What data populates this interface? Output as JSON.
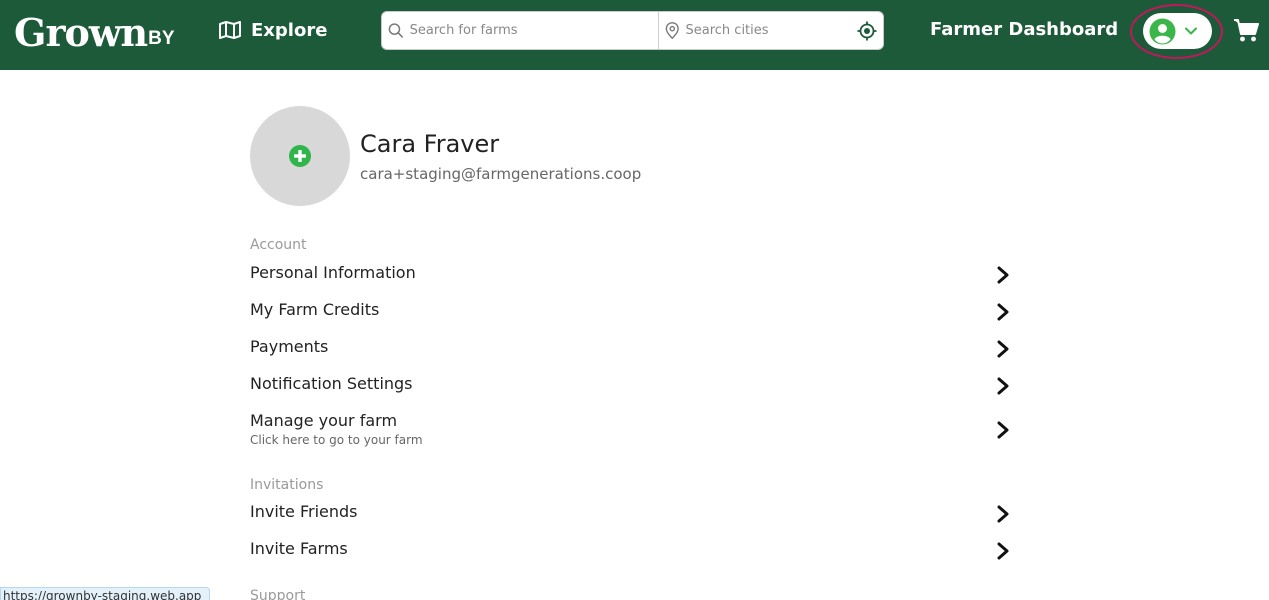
{
  "brand": {
    "logo_main": "Grown",
    "logo_by": "BY"
  },
  "header": {
    "explore_label": "Explore",
    "search_farms_placeholder": "Search for farms",
    "search_cities_placeholder": "Search cities",
    "dashboard_label": "Farmer Dashboard"
  },
  "profile": {
    "name": "Cara Fraver",
    "email": "cara+staging@farmgenerations.coop"
  },
  "sections": {
    "account": {
      "title": "Account",
      "items": [
        {
          "label": "Personal Information"
        },
        {
          "label": "My Farm Credits"
        },
        {
          "label": "Payments"
        },
        {
          "label": "Notification Settings"
        },
        {
          "label": "Manage your farm",
          "subtitle": "Click here to go to your farm"
        }
      ]
    },
    "invitations": {
      "title": "Invitations",
      "items": [
        {
          "label": "Invite Friends"
        },
        {
          "label": "Invite Farms"
        }
      ]
    },
    "support": {
      "title": "Support"
    }
  },
  "status_bar": {
    "url": "https://grownby-staging.web.app"
  },
  "colors": {
    "header_bg": "#1d5a3a",
    "accent_green": "#3cb54a",
    "highlight_ring": "#c2185b",
    "avatar_bg": "#d8d8d8"
  },
  "icons": [
    "map-icon",
    "search-icon",
    "location-pin-icon",
    "crosshair-icon",
    "user-avatar-icon",
    "chevron-down-icon",
    "cart-icon",
    "plus-circle-icon",
    "chevron-right-icon"
  ]
}
